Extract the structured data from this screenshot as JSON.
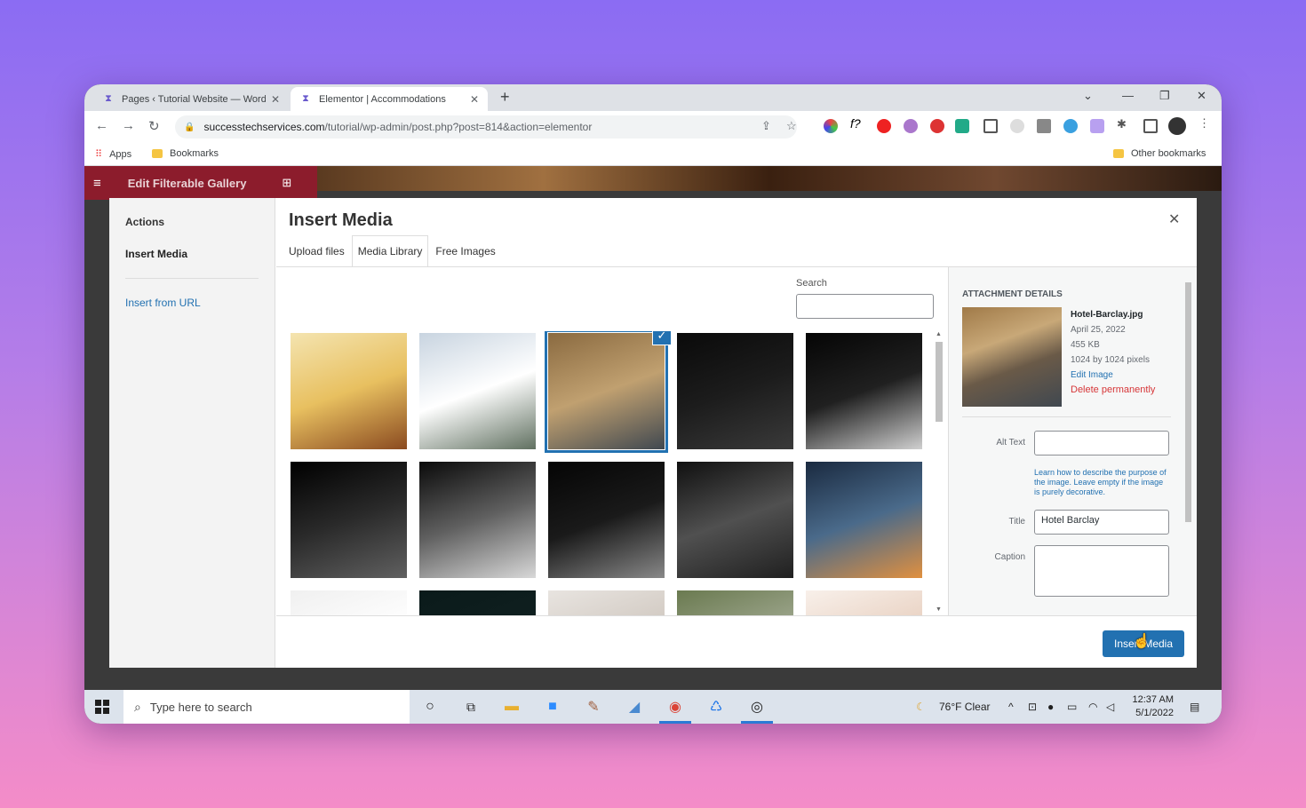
{
  "browser": {
    "tabs": [
      {
        "title": "Pages ‹ Tutorial Website — WordPress",
        "active": false
      },
      {
        "title": "Elementor | Accommodations",
        "active": true
      }
    ],
    "new_tab": "+",
    "url_domain": "successtechservices.com",
    "url_path": "/tutorial/wp-admin/post.php?post=814&action=elementor",
    "bookmarks": {
      "apps": "Apps",
      "bookmarks": "Bookmarks",
      "other": "Other bookmarks"
    }
  },
  "elementor": {
    "title": "Edit Filterable Gallery"
  },
  "modal": {
    "title": "Insert Media",
    "sidebar": {
      "heading": "Actions",
      "active": "Insert Media",
      "link": "Insert from URL"
    },
    "tabs": [
      "Upload files",
      "Media Library",
      "Free Images"
    ],
    "search_label": "Search",
    "thumbnails": [
      {
        "name": "yellow-villa",
        "colors": [
          "#f4e4b0",
          "#e8c060",
          "#8a4a20"
        ]
      },
      {
        "name": "white-house",
        "colors": [
          "#c8d4e0",
          "#ffffff",
          "#607060"
        ]
      },
      {
        "name": "hotel-barclay",
        "colors": [
          "#8a6a40",
          "#c0a070",
          "#404850"
        ]
      },
      {
        "name": "bicycle-dark",
        "colors": [
          "#0a0a0a",
          "#1c1c1c",
          "#3a3a3a"
        ]
      },
      {
        "name": "smoke-hand",
        "colors": [
          "#050505",
          "#202020",
          "#d0d0d0"
        ]
      },
      {
        "name": "dark-corridor",
        "colors": [
          "#000000",
          "#2a2a2a",
          "#606060"
        ]
      },
      {
        "name": "white-rose",
        "colors": [
          "#0a0a0a",
          "#606060",
          "#d8d8d8"
        ]
      },
      {
        "name": "praying-hands",
        "colors": [
          "#050505",
          "#1a1a1a",
          "#888888"
        ]
      },
      {
        "name": "city-aerial",
        "colors": [
          "#101010",
          "#505050",
          "#202020"
        ]
      },
      {
        "name": "lit-building",
        "colors": [
          "#1a2a40",
          "#4a6a8a",
          "#e09040"
        ]
      },
      {
        "name": "white-partial",
        "colors": [
          "#f0f0f0",
          "#ffffff",
          "#e0e0e0"
        ]
      },
      {
        "name": "night-sky",
        "colors": [
          "#0a1a1a",
          "#102020",
          "#0a1010"
        ]
      },
      {
        "name": "light-partial",
        "colors": [
          "#e8e4e0",
          "#d0c8c0",
          "#f0ece8"
        ]
      },
      {
        "name": "trees-partial",
        "colors": [
          "#6a7a50",
          "#a0a890",
          "#304020"
        ]
      },
      {
        "name": "beige-partial",
        "colors": [
          "#f8f0ea",
          "#e8d0c0",
          "#ffffff"
        ]
      }
    ],
    "selected_index": 2,
    "details": {
      "heading": "Attachment Details",
      "filename": "Hotel-Barclay.jpg",
      "date": "April 25, 2022",
      "size": "455 KB",
      "dimensions": "1024 by 1024 pixels",
      "edit": "Edit Image",
      "delete": "Delete permanently",
      "alt_label": "Alt Text",
      "alt_value": "",
      "help": "Learn how to describe the purpose of the image. Leave empty if the image is purely decorative.",
      "title_label": "Title",
      "title_value": "Hotel Barclay",
      "caption_label": "Caption",
      "caption_value": ""
    },
    "insert_button": "Insert Media"
  },
  "taskbar": {
    "search_placeholder": "Type here to search",
    "weather": "76°F  Clear",
    "time": "12:37 AM",
    "date": "5/1/2022"
  }
}
